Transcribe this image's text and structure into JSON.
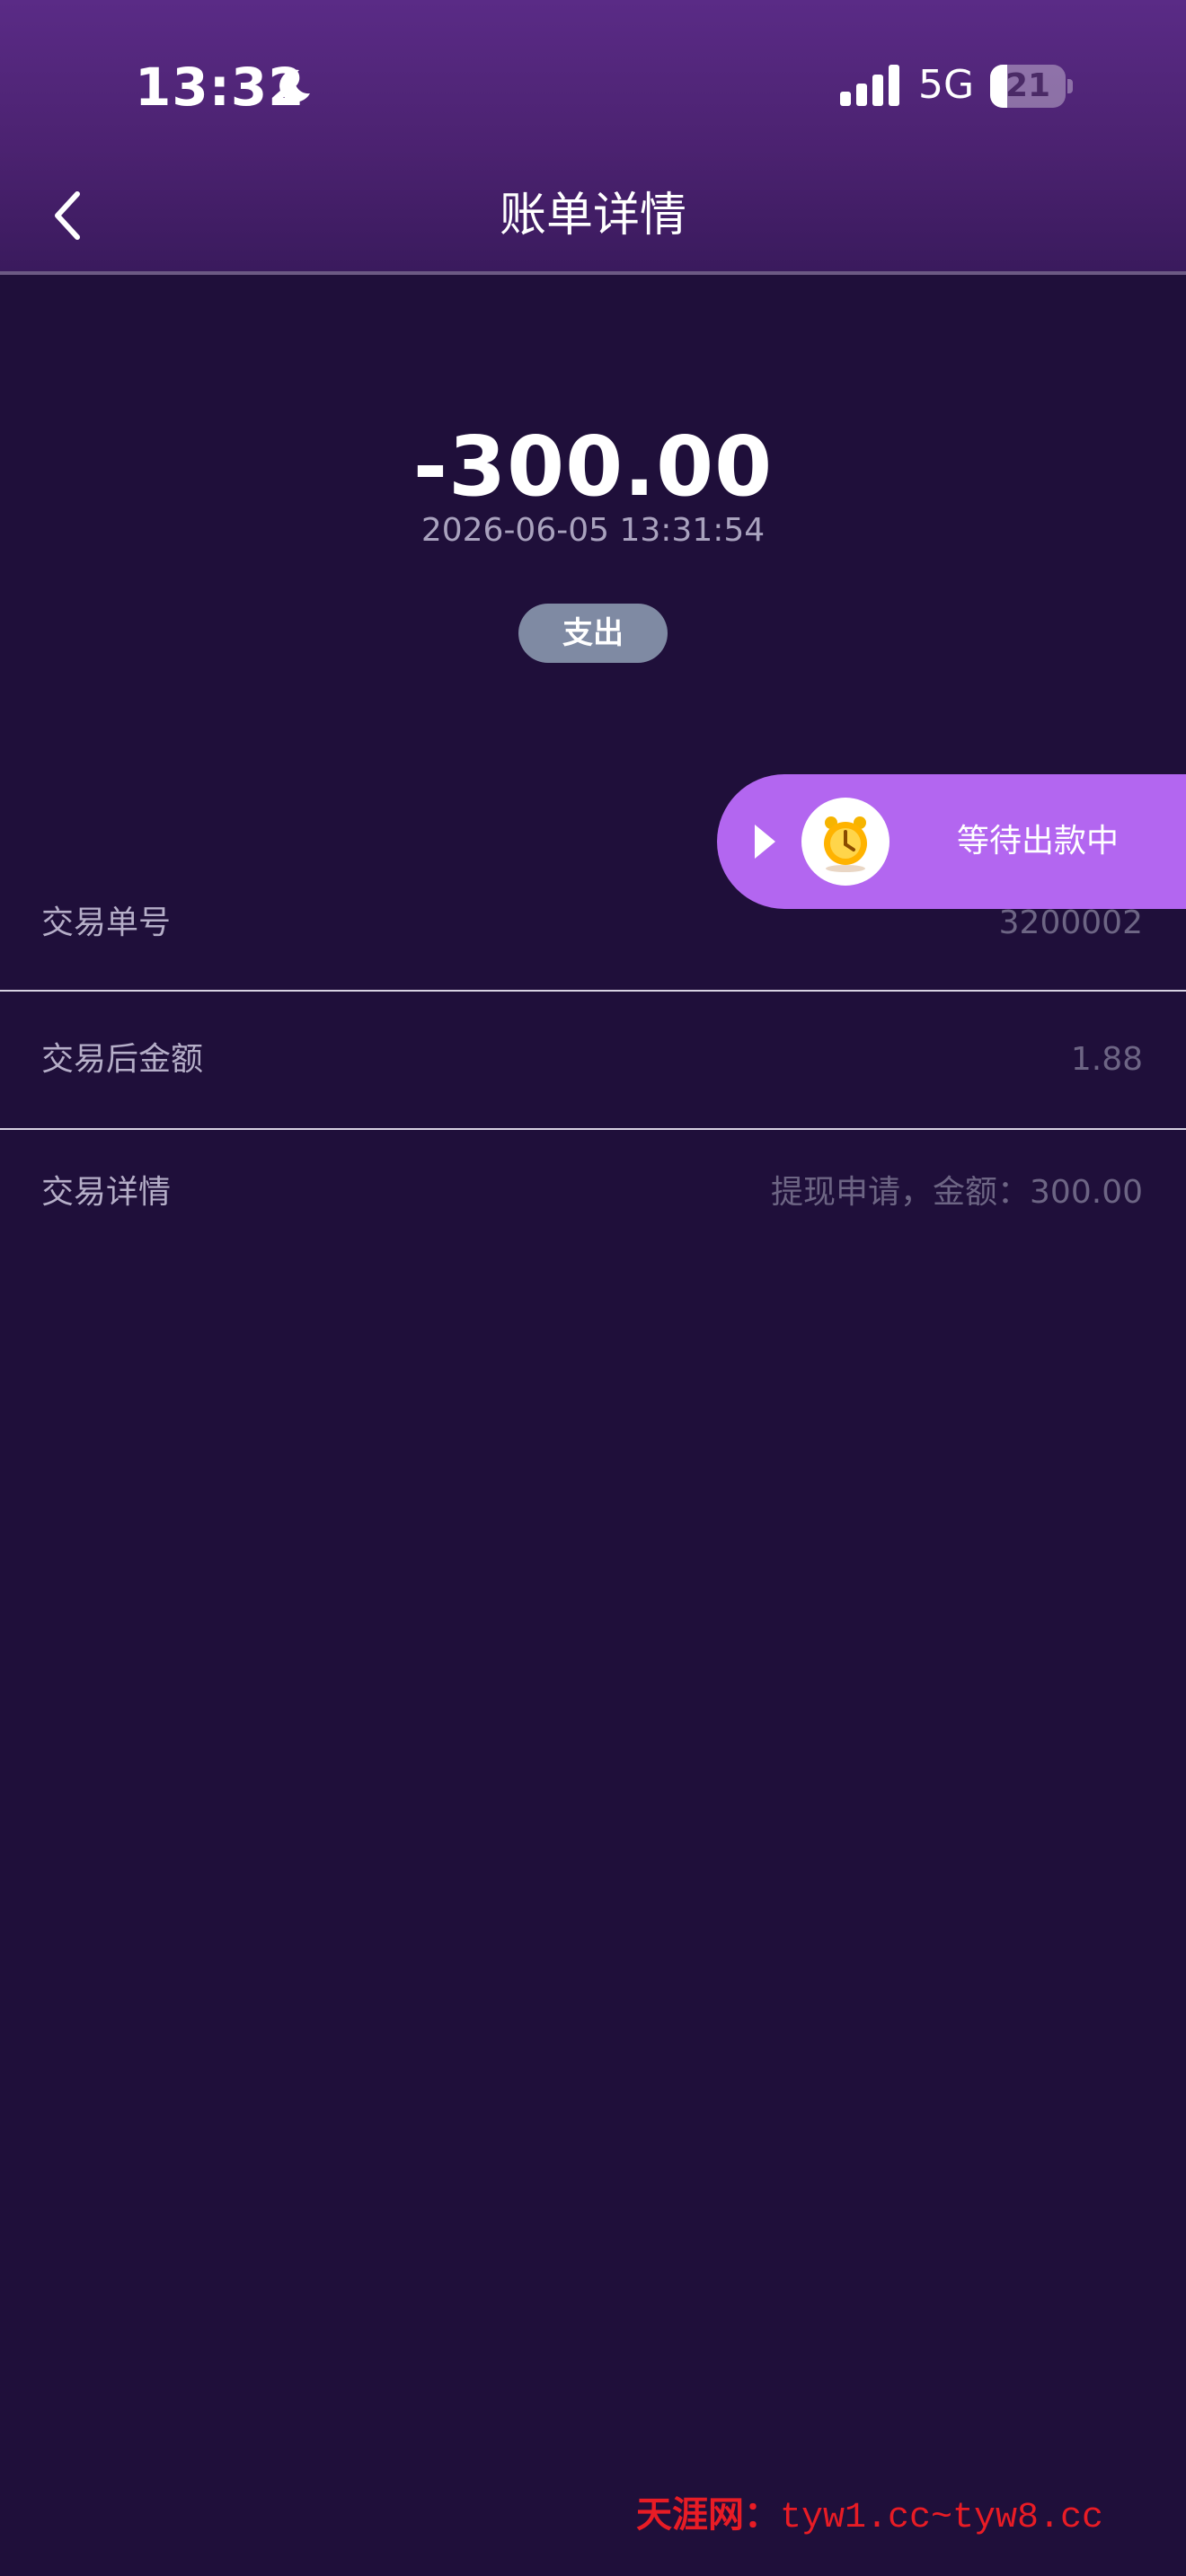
{
  "status_bar": {
    "time": "13:32",
    "network": "5G",
    "battery_level": "21",
    "battery_fraction": 0.21
  },
  "header": {
    "title": "账单详情",
    "back_icon": "chevron-left-icon"
  },
  "summary": {
    "amount": "-300.00",
    "datetime": "2026-06-05 13:31:54",
    "type_badge": "支出"
  },
  "pending_status": {
    "text": "等待出款中",
    "icon": "alarm-clock-icon"
  },
  "details": [
    {
      "label": "交易单号",
      "value": "3200002"
    },
    {
      "label": "交易后金额",
      "value": "1.88"
    },
    {
      "label": "交易详情",
      "value": "提现申请，金额：300.00"
    }
  ],
  "watermark": {
    "name": "天涯网：",
    "url": "tyw1.cc~tyw8.cc"
  },
  "colors": {
    "background": "#1f0f3a",
    "header_top": "#5a2b86",
    "pill": "#b366f0",
    "badge": "#7f8aa3",
    "watermark": "#e81c25"
  }
}
